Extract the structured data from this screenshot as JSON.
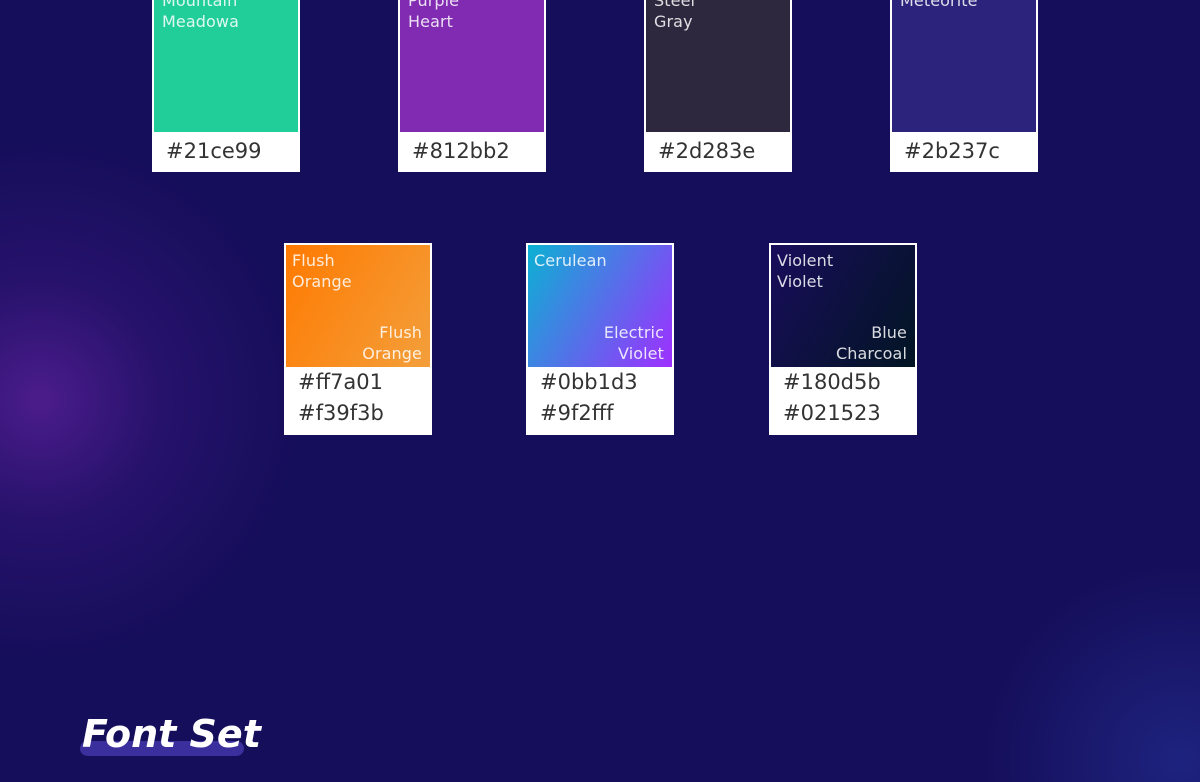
{
  "solid_swatches": [
    {
      "name_line1": "Mountain",
      "name_line2": "Meadowa",
      "code": "#21ce99",
      "color": "#21ce99"
    },
    {
      "name_line1": "Purple",
      "name_line2": "Heart",
      "code": "#812bb2",
      "color": "#812bb2"
    },
    {
      "name_line1": "Steel",
      "name_line2": "Gray",
      "code": "#2d283e",
      "color": "#2d283e"
    },
    {
      "name_line1": "Meteorite",
      "name_line2": "",
      "code": "#2b237c",
      "color": "#2b237c"
    }
  ],
  "gradient_swatches": [
    {
      "start_name_line1": "Flush",
      "start_name_line2": "Orange",
      "end_name_line1": "Flush",
      "end_name_line2": "Orange",
      "code_start": "#ff7a01",
      "code_end": "#f39f3b",
      "color_start": "#ff7a01",
      "color_end": "#f39f3b"
    },
    {
      "start_name_line1": "Cerulean",
      "start_name_line2": "",
      "end_name_line1": "Electric",
      "end_name_line2": "Violet",
      "code_start": "#0bb1d3",
      "code_end": "#9f2fff",
      "color_start": "#0bb1d3",
      "color_end": "#9f2fff"
    },
    {
      "start_name_line1": "Violent",
      "start_name_line2": "Violet",
      "end_name_line1": "Blue",
      "end_name_line2": "Charcoal",
      "code_start": "#180d5b",
      "code_end": "#021523",
      "color_start": "#180d5b",
      "color_end": "#021523"
    }
  ],
  "section_title": "Font Set",
  "colors": {
    "background": "#150e5a",
    "title_highlight": "#3a2f9c",
    "card_border": "#ffffff",
    "code_text": "#333333"
  }
}
